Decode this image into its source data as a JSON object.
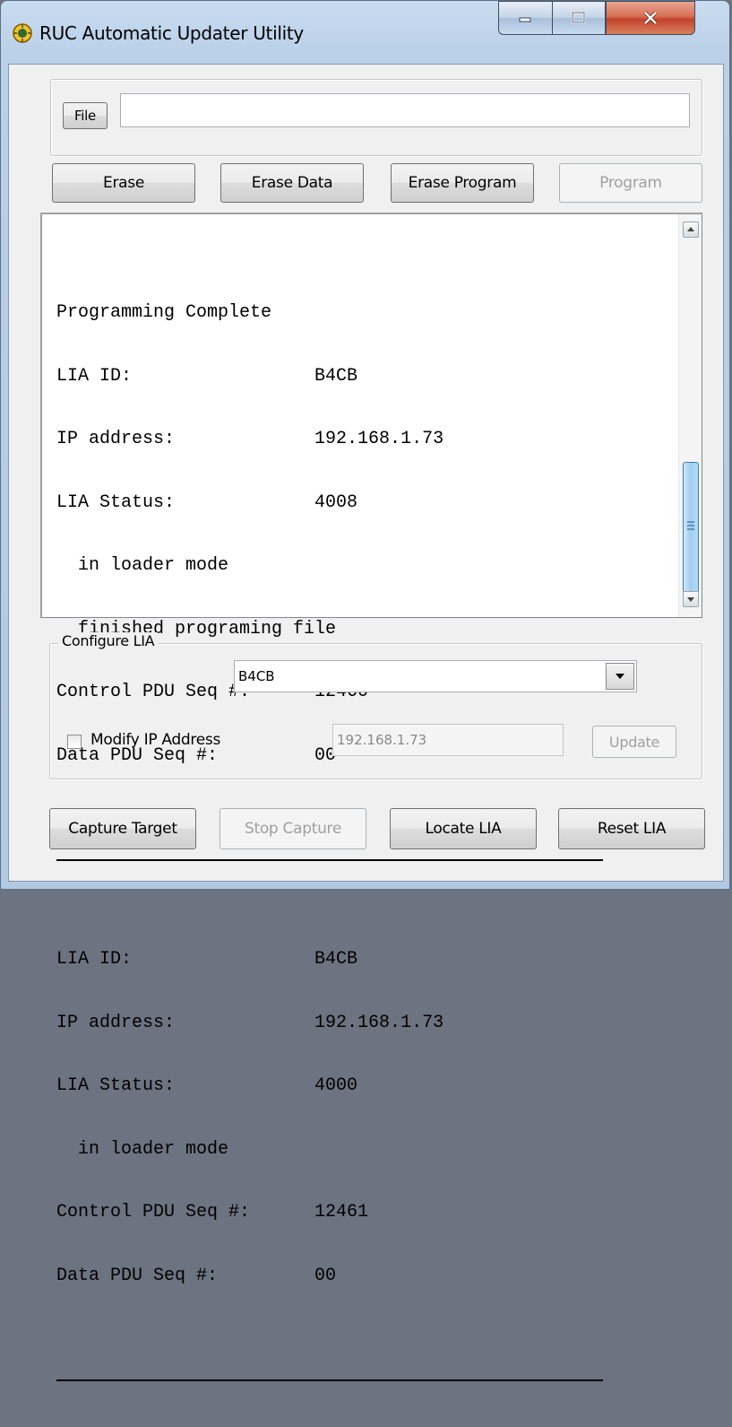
{
  "window": {
    "title": "RUC Automatic Updater Utility",
    "icons": {
      "app": "gear-app-icon",
      "minimize": "minimize-icon",
      "maximize": "maximize-icon",
      "close": "close-icon"
    }
  },
  "file_group": {
    "file_button": "File",
    "file_path": ""
  },
  "actions": {
    "erase": "Erase",
    "erase_data": "Erase Data",
    "erase_program": "Erase Program",
    "program": "Program"
  },
  "log": {
    "blocks": [
      [
        "Programming Complete",
        "LIA ID:                 B4CB",
        "IP address:             192.168.1.73",
        "LIA Status:             4008",
        "  in loader mode",
        "  finished programing file",
        "Control PDU Seq #:      12460",
        "Data PDU Seq #:         00"
      ],
      [
        "LIA ID:                 B4CB",
        "IP address:             192.168.1.73",
        "LIA Status:             4000",
        "  in loader mode",
        "Control PDU Seq #:      12461",
        "Data PDU Seq #:         00"
      ]
    ]
  },
  "configure": {
    "legend": "Configure LIA",
    "selected_lia": "B4CB",
    "modify_ip_label": "Modify IP Address",
    "modify_ip_checked": false,
    "ip_value": "192.168.1.73",
    "update_button": "Update"
  },
  "bottom": {
    "capture_target": "Capture Target",
    "stop_capture": "Stop Capture",
    "locate_lia": "Locate LIA",
    "reset_lia": "Reset LIA"
  },
  "colors": {
    "title_bg": "#b9d0e8",
    "close_red": "#c3422a",
    "scroll_thumb": "#9fcdf3"
  }
}
